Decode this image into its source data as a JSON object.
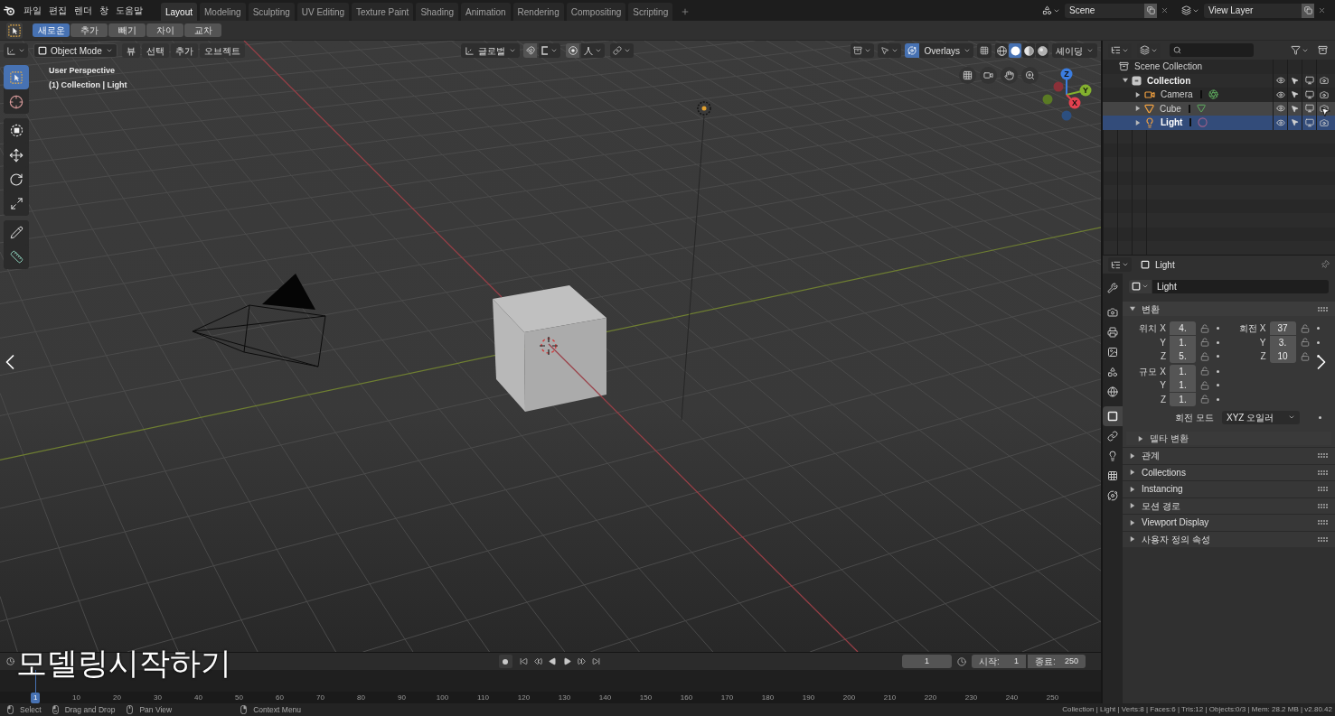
{
  "top_bar": {
    "menus": [
      "파일",
      "편집",
      "렌더",
      "창",
      "도움말"
    ],
    "workspace_tabs": [
      {
        "label": "Layout",
        "selected": true
      },
      {
        "label": "Modeling",
        "selected": false
      },
      {
        "label": "Sculpting",
        "selected": false
      },
      {
        "label": "UV Editing",
        "selected": false
      },
      {
        "label": "Texture Paint",
        "selected": false
      },
      {
        "label": "Shading",
        "selected": false
      },
      {
        "label": "Animation",
        "selected": false
      },
      {
        "label": "Rendering",
        "selected": false
      },
      {
        "label": "Compositing",
        "selected": false
      },
      {
        "label": "Scripting",
        "selected": false
      }
    ],
    "scene": "Scene",
    "view_layer": "View Layer"
  },
  "tool_settings": {
    "selection_modes": [
      {
        "label": "새로운",
        "selected": true
      },
      {
        "label": "추가",
        "selected": false
      },
      {
        "label": "빼기",
        "selected": false
      },
      {
        "label": "차이",
        "selected": false
      },
      {
        "label": "교차",
        "selected": false
      }
    ]
  },
  "viewport": {
    "header": {
      "mode": "Object Mode",
      "menus": [
        "뷰",
        "선택",
        "추가",
        "오브젝트"
      ],
      "orientation": "글로벌",
      "snap": {
        "on": false
      },
      "proportional_editing": {
        "on": false
      },
      "overlays": {
        "label": "Overlays",
        "on": true
      },
      "shading_modes": [
        {
          "kind": "wireframe",
          "selected": false
        },
        {
          "kind": "solid",
          "selected": true
        },
        {
          "kind": "material",
          "selected": false
        },
        {
          "kind": "rendered",
          "selected": false
        }
      ],
      "shading_menu": "셰이딩"
    },
    "tool_groups": [
      {
        "tools": [
          {
            "kind": "select_box",
            "selected": true
          },
          {
            "kind": "cursor",
            "selected": false
          }
        ]
      },
      {
        "tools": [
          {
            "kind": "transform",
            "selected": false
          },
          {
            "kind": "move",
            "selected": false
          },
          {
            "kind": "rotate",
            "selected": false
          },
          {
            "kind": "scale",
            "selected": false
          }
        ]
      },
      {
        "tools": [
          {
            "kind": "annotate",
            "selected": false
          },
          {
            "kind": "measure",
            "selected": false
          }
        ]
      }
    ],
    "info": [
      "User Perspective",
      "(1) Collection | Light"
    ],
    "gizmo_axes": [
      {
        "label": "Z",
        "color": "#3b7de0"
      },
      {
        "label": "Y",
        "color": "#83b12e"
      },
      {
        "label": "X",
        "color": "#e2414f"
      }
    ]
  },
  "outliner": {
    "tree": [
      {
        "label": "Scene Collection",
        "kind": "scene_collection",
        "children": [
          {
            "label": "Collection",
            "kind": "collection",
            "expanded": true,
            "selected": false,
            "hovered": false,
            "children": [
              {
                "label": "Camera",
                "kind": "camera",
                "expanded": false,
                "selected": false,
                "hovered": false
              },
              {
                "label": "Cube",
                "kind": "mesh",
                "expanded": false,
                "selected": false,
                "hovered": true
              },
              {
                "label": "Light",
                "kind": "light",
                "expanded": false,
                "selected": true,
                "hovered": false
              }
            ]
          }
        ]
      }
    ]
  },
  "properties": {
    "title": "Light",
    "name": "Light",
    "tab_groups": [
      {
        "tabs": [
          {
            "kind": "tool",
            "selected": false
          }
        ]
      },
      {
        "tabs": [
          {
            "kind": "render",
            "selected": false
          },
          {
            "kind": "output",
            "selected": false
          },
          {
            "kind": "view_layer",
            "selected": false
          },
          {
            "kind": "scene",
            "selected": false
          },
          {
            "kind": "world",
            "selected": false
          }
        ]
      },
      {
        "tabs": [
          {
            "kind": "object",
            "selected": true
          },
          {
            "kind": "constraints",
            "selected": false
          },
          {
            "kind": "light_data",
            "selected": false
          },
          {
            "kind": "texture",
            "selected": false
          },
          {
            "kind": "physics",
            "selected": false
          }
        ]
      }
    ],
    "transform": {
      "title": "변환",
      "expanded": true,
      "groups": [
        {
          "label": "위치",
          "fields": [
            {
              "axis": "X",
              "value": "4."
            },
            {
              "axis": "Y",
              "value": "1."
            },
            {
              "axis": "Z",
              "value": "5."
            }
          ]
        },
        {
          "label": "회전",
          "fields": [
            {
              "axis": "X",
              "value": "37"
            },
            {
              "axis": "Y",
              "value": "3."
            },
            {
              "axis": "Z",
              "value": "10"
            }
          ]
        },
        {
          "label": "규모",
          "fields": [
            {
              "axis": "X",
              "value": "1."
            },
            {
              "axis": "Y",
              "value": "1."
            },
            {
              "axis": "Z",
              "value": "1."
            }
          ]
        }
      ],
      "rotation_mode": {
        "label": "회전 모드",
        "value": "XYZ 오일러"
      },
      "subpanels": [
        {
          "title": "델타 변환",
          "expanded": false
        }
      ]
    },
    "panels": [
      {
        "title": "관계",
        "expanded": false
      },
      {
        "title": "Collections",
        "expanded": false
      },
      {
        "title": "Instancing",
        "expanded": false
      },
      {
        "title": "모션 경로",
        "expanded": false
      },
      {
        "title": "Viewport Display",
        "expanded": false
      },
      {
        "title": "사용자 정의 속성",
        "expanded": false
      }
    ]
  },
  "timeline": {
    "current_frame": "1",
    "start": {
      "label": "시작:",
      "value": "1"
    },
    "end": {
      "label": "종료:",
      "value": "250"
    },
    "playhead": "1",
    "ruler": [
      "10",
      "20",
      "30",
      "40",
      "50",
      "60",
      "70",
      "80",
      "90",
      "100",
      "110",
      "120",
      "130",
      "140",
      "150",
      "160",
      "170",
      "180",
      "190",
      "200",
      "210",
      "220",
      "230",
      "240",
      "250"
    ]
  },
  "status_bar": {
    "hints": [
      {
        "kind": "left",
        "label": "Select"
      },
      {
        "kind": "left_drag",
        "label": "Drag and Drop"
      },
      {
        "kind": "middle",
        "label": "Pan View"
      },
      {
        "kind": "right",
        "label": "Context Menu"
      }
    ],
    "stats": "Collection | Light | Verts:8 | Faces:6 | Tris:12 | Objects:0/3 | Mem: 28.2 MB | v2.80.42"
  },
  "caption": "모델링시작하기"
}
